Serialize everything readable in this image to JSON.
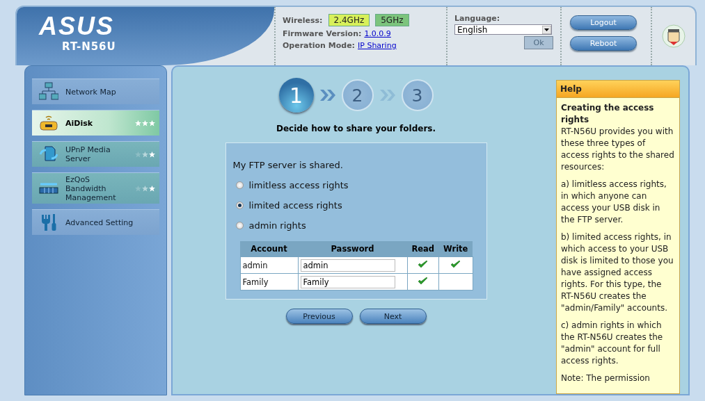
{
  "header": {
    "logo": "ASUS",
    "model": "RT-N56U",
    "wireless_label": "Wireless:",
    "bands": [
      {
        "label": "2.4GHz",
        "color": "#d8f05a"
      },
      {
        "label": "5GHz",
        "color": "#7cc47c"
      }
    ],
    "firmware_label": "Firmware Version:",
    "firmware": "1.0.0.9",
    "mode_label": "Operation Mode:",
    "mode": "IP Sharing",
    "language_label": "Language:",
    "language": "English",
    "ok": {
      "label": "Ok",
      "disabled": true
    },
    "buttons": [
      "Logout",
      "Reboot"
    ]
  },
  "sidebar": {
    "items": [
      {
        "label": "Network Map",
        "kind": "network",
        "selected": false
      },
      {
        "label": "AiDisk",
        "kind": "disk",
        "selected": true
      },
      {
        "label": "UPnP Media Server",
        "kind": "media",
        "selected": false
      },
      {
        "label": "EzQoS Bandwidth Management",
        "kind": "qos",
        "selected": false
      },
      {
        "label": "Advanced Setting",
        "kind": "tools",
        "selected": false
      }
    ]
  },
  "wizard": {
    "steps": [
      {
        "label": "1",
        "selected": true
      },
      {
        "label": "2",
        "selected": false
      },
      {
        "label": "3",
        "selected": false
      }
    ],
    "caption": "Decide how to share your folders.",
    "intro": "My FTP server is shared.",
    "options": [
      {
        "label": "limitless access rights",
        "selected": false
      },
      {
        "label": "limited access rights",
        "selected": true
      },
      {
        "label": "admin rights",
        "selected": false
      }
    ],
    "table": {
      "columns": [
        "Account",
        "Password",
        "Read",
        "Write"
      ],
      "rows": [
        {
          "account": "admin",
          "password": "admin",
          "read": true,
          "write": true
        },
        {
          "account": "Family",
          "password": "Family",
          "read": true,
          "write": false
        }
      ]
    },
    "buttons": [
      "Previous",
      "Next"
    ]
  },
  "help": {
    "title": "Help",
    "heading": "Creating the access rights",
    "paragraphs": [
      "RT-N56U provides you with these three types of access rights to the shared resources:",
      "a) limitless access rights, in which anyone can access your USB disk in the FTP server.",
      "b) limited access rights, in which access to your USB disk is limited to those you have assigned access rights. For this type, the RT-N56U creates the \"admin/Family\" accounts.",
      "c) admin rights in which the RT-N56U creates the \"admin\" account for full access rights.",
      "Note: The permission"
    ]
  }
}
